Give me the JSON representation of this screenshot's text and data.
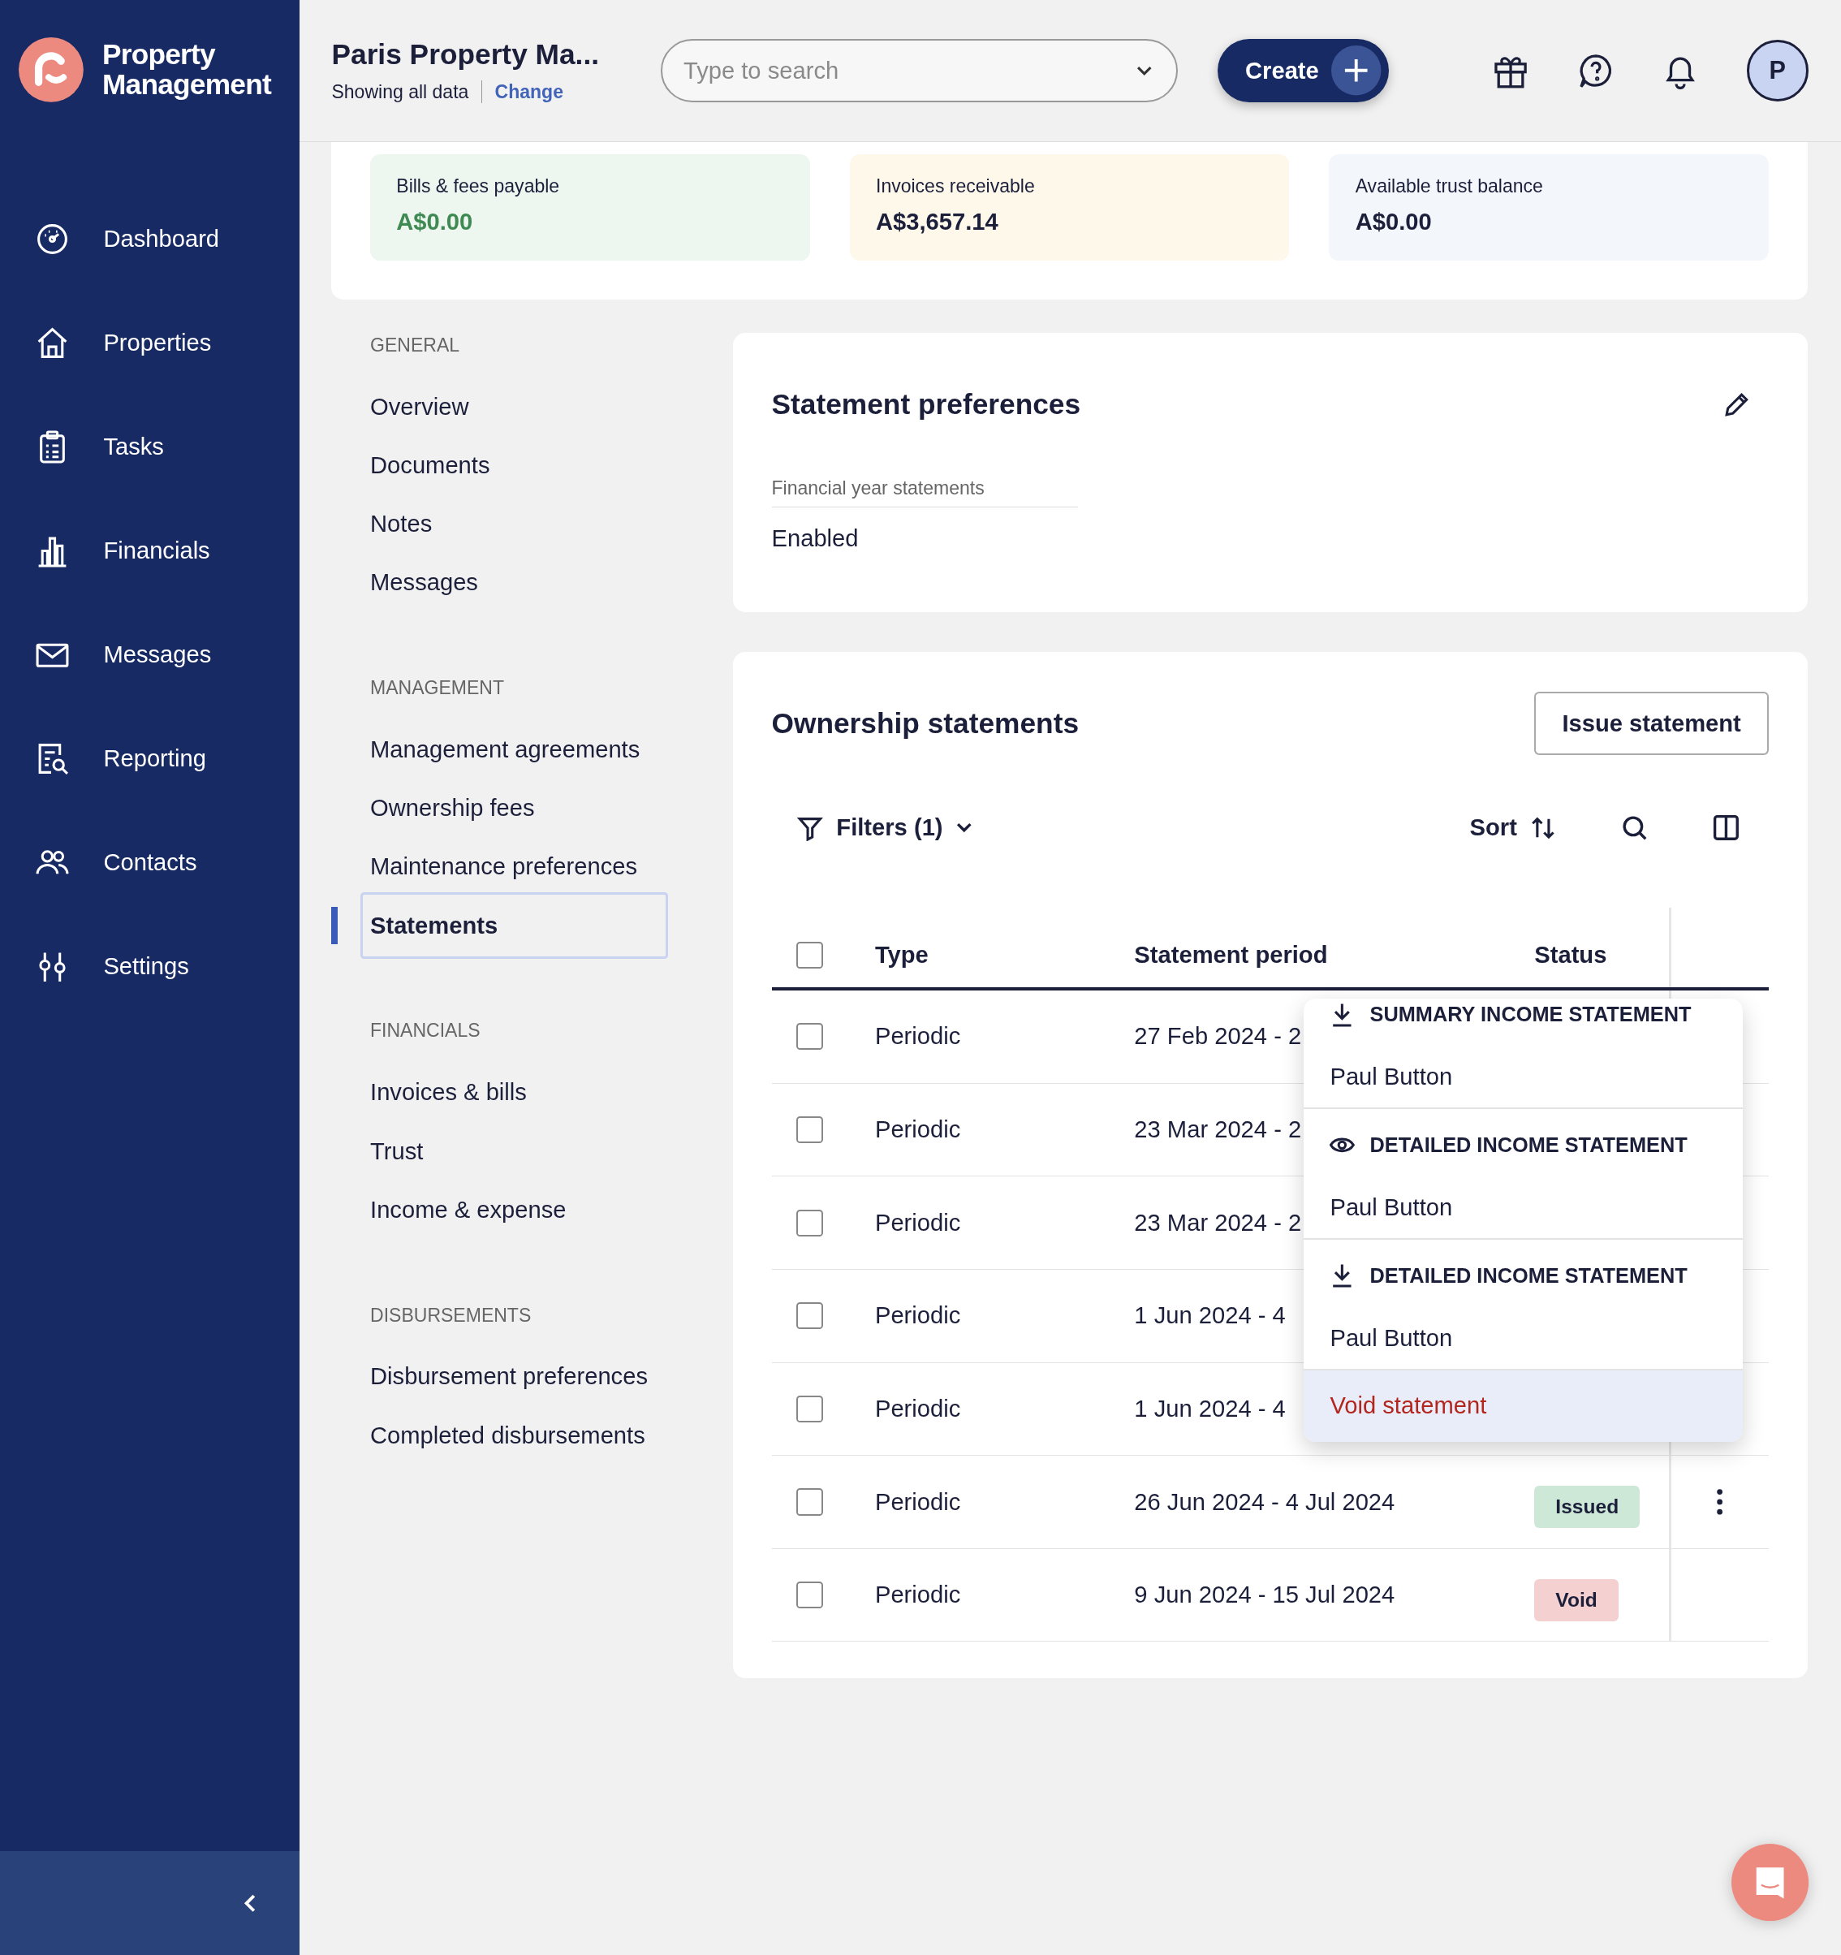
{
  "brand": {
    "name": "Property Management"
  },
  "sidebar": {
    "items": [
      {
        "label": "Dashboard"
      },
      {
        "label": "Properties"
      },
      {
        "label": "Tasks"
      },
      {
        "label": "Financials"
      },
      {
        "label": "Messages"
      },
      {
        "label": "Reporting"
      },
      {
        "label": "Contacts"
      },
      {
        "label": "Settings"
      }
    ]
  },
  "header": {
    "title": "Paris Property Ma...",
    "subtitle": "Showing all data",
    "change_link": "Change",
    "search": {
      "placeholder": "Type to search"
    },
    "create_button": "Create",
    "avatar": "P"
  },
  "summary": [
    {
      "label": "Bills & fees payable",
      "value": "A$0.00",
      "color": "#eef7ef"
    },
    {
      "label": "Invoices receivable",
      "value": "A$3,657.14",
      "color": "#fdf8ea"
    },
    {
      "label": "Available trust balance",
      "value": "A$0.00",
      "color": "#f3f6fb"
    }
  ],
  "subnav": [
    {
      "heading": "GENERAL",
      "items": [
        {
          "label": "Overview",
          "selected": false
        },
        {
          "label": "Documents",
          "selected": false
        },
        {
          "label": "Notes",
          "selected": false
        },
        {
          "label": "Messages",
          "selected": false
        }
      ]
    },
    {
      "heading": "MANAGEMENT",
      "items": [
        {
          "label": "Management agreements",
          "selected": false
        },
        {
          "label": "Ownership fees",
          "selected": false
        },
        {
          "label": "Maintenance preferences",
          "selected": false
        },
        {
          "label": "Statements",
          "selected": true
        }
      ]
    },
    {
      "heading": "FINANCIALS",
      "items": [
        {
          "label": "Invoices & bills",
          "selected": false
        },
        {
          "label": "Trust",
          "selected": false
        },
        {
          "label": "Income & expense",
          "selected": false
        }
      ]
    },
    {
      "heading": "DISBURSEMENTS",
      "items": [
        {
          "label": "Disbursement preferences",
          "selected": false
        },
        {
          "label": "Completed disbursements",
          "selected": false
        }
      ]
    }
  ],
  "statement_preferences": {
    "title": "Statement preferences",
    "field_label": "Financial year statements",
    "field_value": "Enabled"
  },
  "ownership_statements": {
    "title": "Ownership statements",
    "issue_button": "Issue statement",
    "filters": "Filters (1)",
    "sort": "Sort",
    "table": {
      "select_all_checked": false,
      "columns": [
        "Type",
        "Statement period",
        "Status"
      ],
      "rows": [
        {
          "type": "Periodic",
          "period": "27 Feb 2024 - 2",
          "checked": false
        },
        {
          "type": "Periodic",
          "period": "23 Mar 2024 - 2",
          "checked": false
        },
        {
          "type": "Periodic",
          "period": "23 Mar 2024 - 2",
          "checked": false
        },
        {
          "type": "Periodic",
          "period": "1 Jun 2024 - 4",
          "checked": false
        },
        {
          "type": "Periodic",
          "period": "1 Jun 2024 - 4",
          "checked": false
        },
        {
          "type": "Periodic",
          "period": "26 Jun 2024 - 4 Jul 2024",
          "checked": false,
          "actions": true,
          "status": {
            "label": "Issued",
            "color": "#cde8d7"
          }
        },
        {
          "type": "Periodic",
          "period": "9 Jun 2024 - 15 Jul 2024",
          "checked": false,
          "actions": false,
          "status": {
            "label": "Void",
            "color": "#f5d0d0"
          }
        }
      ]
    },
    "menu": {
      "sections": [
        {
          "kind": "download",
          "title": "SUMMARY INCOME STATEMENT",
          "name": "Paul Button"
        },
        {
          "kind": "view",
          "title": "DETAILED INCOME STATEMENT",
          "name": "Paul Button"
        },
        {
          "kind": "download",
          "title": "DETAILED INCOME STATEMENT",
          "name": "Paul Button"
        }
      ],
      "void_action": {
        "label": "Void statement",
        "highlighted": true
      }
    }
  }
}
